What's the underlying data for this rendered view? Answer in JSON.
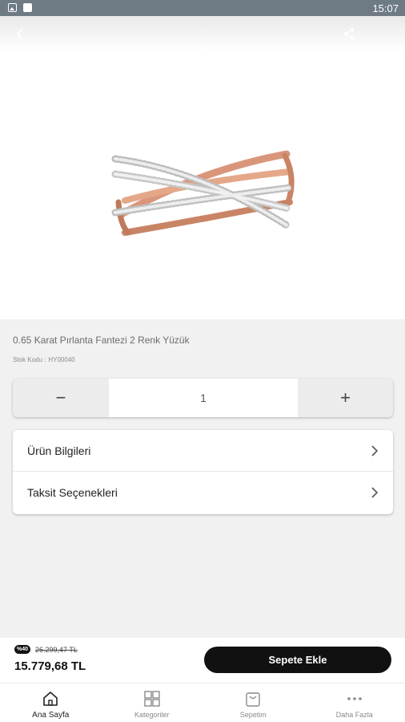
{
  "status_bar": {
    "time": "15:07"
  },
  "header": {
    "back_icon": "chevron-left-icon",
    "share_icon": "share-icon"
  },
  "product": {
    "title": "0.65 Karat Pırlanta Fantezi 2 Renk Yüzük",
    "stock_label": "Stok Kodu :",
    "stock_code": "HY00040"
  },
  "quantity": {
    "minus": "−",
    "value": "1",
    "plus": "+"
  },
  "info_rows": [
    {
      "label": "Ürün Bilgileri"
    },
    {
      "label": "Taksit Seçenekleri"
    }
  ],
  "cart": {
    "discount_badge": "%40",
    "old_price": "26.299,47 TL",
    "price": "15.779,68 TL",
    "add_to_cart_label": "Sepete Ekle"
  },
  "bottom_nav": [
    {
      "label": "Ana Sayfa",
      "icon": "home-icon",
      "active": true
    },
    {
      "label": "Kategoriler",
      "icon": "grid-icon",
      "active": false
    },
    {
      "label": "Sepetim",
      "icon": "shopping-bag-icon",
      "active": false
    },
    {
      "label": "Daha Fazla",
      "icon": "more-dots-icon",
      "active": false
    }
  ],
  "colors": {
    "accent": "#111111",
    "background": "#f1f1f1",
    "status_bar": "#6e7a84"
  }
}
